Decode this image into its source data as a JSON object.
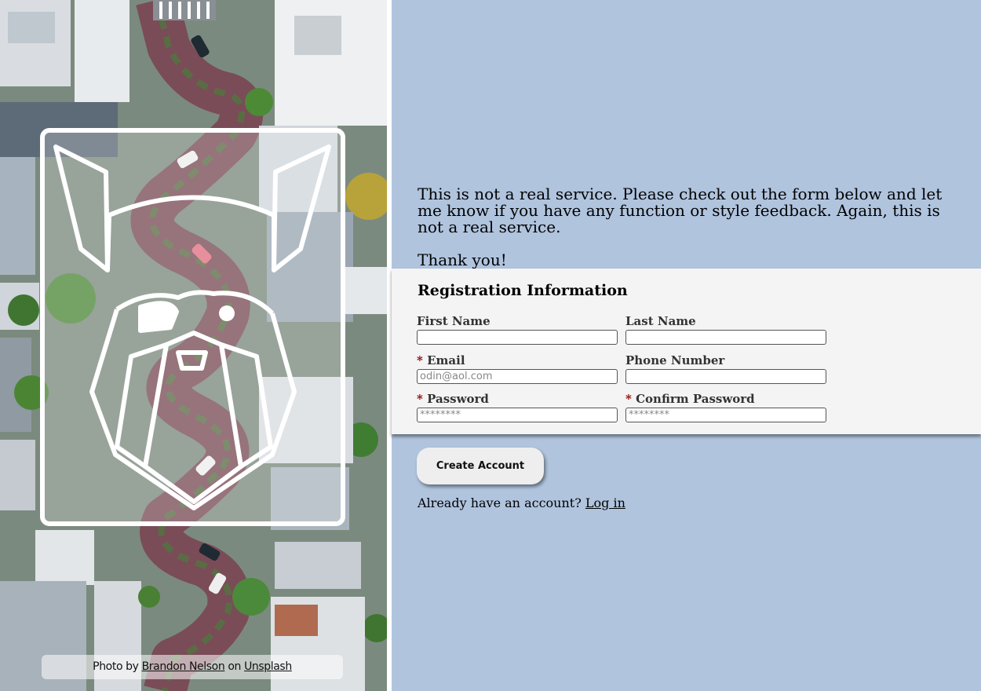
{
  "hero": {
    "credit_prefix": "Photo by",
    "photographer": "Brandon Nelson",
    "credit_mid": "on",
    "source": "Unsplash"
  },
  "intro": {
    "message": "This is not a real service. Please check out the form below and let me know if you have any function or style feedback. Again, this is not a real service.",
    "thanks": "Thank you!"
  },
  "form": {
    "title": "Registration Information",
    "required_mark": "*",
    "first_name": {
      "label": "First Name",
      "value": "",
      "placeholder": ""
    },
    "last_name": {
      "label": "Last Name",
      "value": "",
      "placeholder": ""
    },
    "email": {
      "label": "Email",
      "value": "",
      "placeholder": "odin@aol.com"
    },
    "phone": {
      "label": "Phone Number",
      "value": "",
      "placeholder": ""
    },
    "password": {
      "label": "Password",
      "value": "",
      "placeholder": "********"
    },
    "confirm_password": {
      "label": "Confirm Password",
      "value": "",
      "placeholder": "********"
    }
  },
  "actions": {
    "create_label": "Create Account",
    "login_prompt": "Already have an account?",
    "login_link": "Log in"
  },
  "colors": {
    "background": "#b0c4de",
    "form_panel": "#f4f4f4",
    "required": "#8b0000"
  }
}
